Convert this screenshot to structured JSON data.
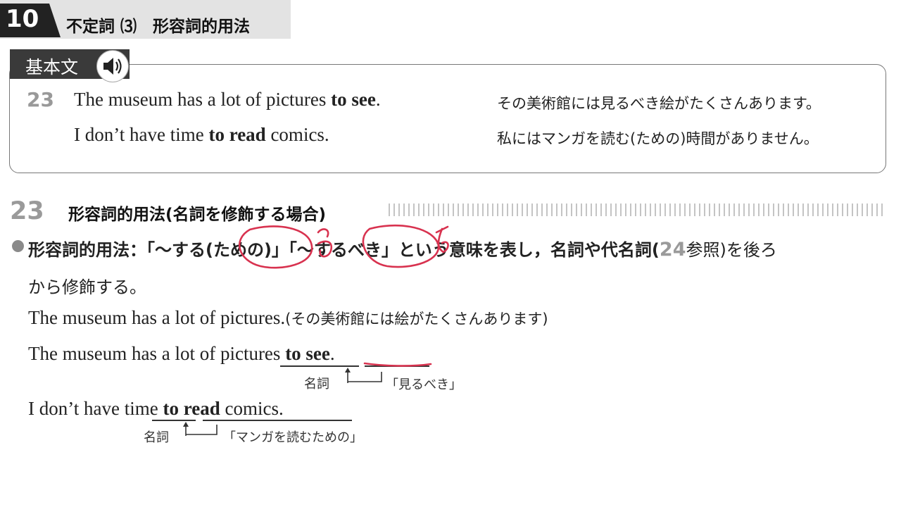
{
  "header": {
    "lesson_number": "10",
    "lesson_title": "不定詞 ⑶　形容詞的用法"
  },
  "basic_box": {
    "tab_label": "基本文",
    "example_number": "23",
    "lines": [
      {
        "en_pre": "The museum has a lot of pictures ",
        "en_bold": "to see",
        "en_post": ".",
        "jp": "その美術館には見るべき絵がたくさんあります。"
      },
      {
        "en_pre": "I don’t have time ",
        "en_bold": "to read",
        "en_post": " comics.",
        "jp": "私にはマンガを読む(ための)時間がありません。"
      }
    ]
  },
  "section": {
    "number": "23",
    "title": "形容詞的用法(名詞を修飾する場合)"
  },
  "explanation": {
    "line1_a": "形容詞的用法：「〜する(ための)」「〜するべき」という意味を表し，名詞や代名詞(",
    "ref_number": "24",
    "line1_b": "参照)を後ろ",
    "line2": "から修飾する。"
  },
  "examples": [
    {
      "en": "The museum has a lot of pictures.",
      "jp": "(その美術館には絵がたくさんあります)"
    },
    {
      "en_pre": "The museum has a lot of ",
      "noun": "pictures",
      "bold": "to see",
      "en_post": ".",
      "label_noun": "名詞",
      "label_gloss": "「見るべき」"
    },
    {
      "en_pre": "I don’t have ",
      "noun": "time",
      "bold": "to read",
      "en_post": " comics.",
      "label_noun": "名詞",
      "label_gloss": "「マンガを読むための」"
    }
  ],
  "colors": {
    "handwriting": "#d8324f",
    "accent_gray": "#9a9a9a",
    "header_band": "#e3e3e3"
  }
}
